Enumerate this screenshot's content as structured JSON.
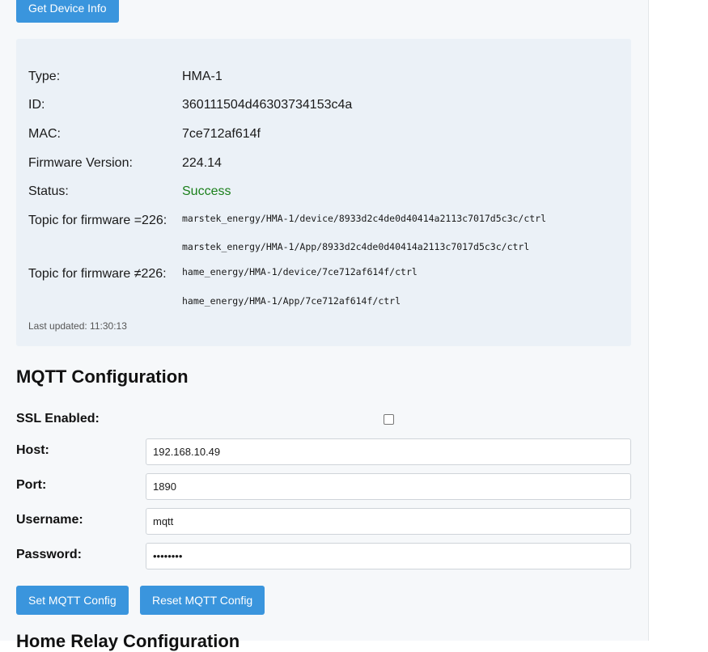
{
  "buttons": {
    "get_device_info": "Get Device Info",
    "set_mqtt": "Set MQTT Config",
    "reset_mqtt": "Reset MQTT Config"
  },
  "device_info": {
    "type_label": "Type:",
    "type_value": "HMA-1",
    "id_label": "ID:",
    "id_value": "360111504d46303734153c4a",
    "mac_label": "MAC:",
    "mac_value": "7ce712af614f",
    "firmware_label": "Firmware Version:",
    "firmware_value": "224.14",
    "status_label": "Status:",
    "status_value": "Success",
    "topic_226_label": "Topic for firmware =226:",
    "topic_226_device": "marstek_energy/HMA-1/device/8933d2c4de0d40414a2113c7017d5c3c/ctrl",
    "topic_226_app": "marstek_energy/HMA-1/App/8933d2c4de0d40414a2113c7017d5c3c/ctrl",
    "topic_not226_label": "Topic for firmware ≠226:",
    "topic_not226_device": "hame_energy/HMA-1/device/7ce712af614f/ctrl",
    "topic_not226_app": "hame_energy/HMA-1/App/7ce712af614f/ctrl",
    "last_updated": "Last updated: 11:30:13"
  },
  "mqtt": {
    "title": "MQTT Configuration",
    "ssl_label": "SSL Enabled:",
    "ssl_enabled": false,
    "host_label": "Host:",
    "host_value": "192.168.10.49",
    "port_label": "Port:",
    "port_value": "1890",
    "username_label": "Username:",
    "username_value": "mqtt",
    "password_label": "Password:",
    "password_value": "••••••••"
  },
  "next_section": {
    "title": "Home Relay Configuration"
  },
  "colors": {
    "accent": "#3a95dd",
    "success": "#1a7f1a",
    "panel": "#ebf1f7",
    "page": "#f6f8fa"
  }
}
